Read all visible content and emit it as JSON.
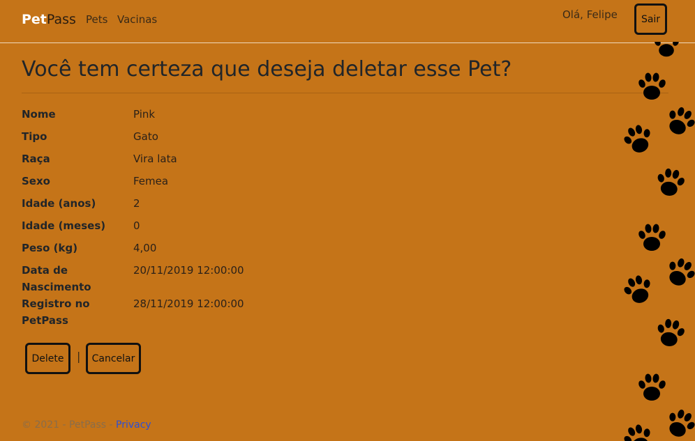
{
  "navbar": {
    "brand_bold": "Pet",
    "brand_light": "Pass",
    "links": [
      "Pets",
      "Vacinas"
    ],
    "greeting": "Olá, Felipe",
    "logout_label": "Sair"
  },
  "page": {
    "title": "Você tem certeza que deseja deletar esse Pet?"
  },
  "details": {
    "nome": {
      "label": "Nome",
      "value": "Pink"
    },
    "tipo": {
      "label": "Tipo",
      "value": "Gato"
    },
    "raca": {
      "label": "Raça",
      "value": "Vira lata"
    },
    "sexo": {
      "label": "Sexo",
      "value": "Femea"
    },
    "idade_anos": {
      "label": "Idade (anos)",
      "value": "2"
    },
    "idade_meses": {
      "label": "Idade (meses)",
      "value": "0"
    },
    "peso": {
      "label": "Peso (kg)",
      "value": "4,00"
    },
    "nascimento": {
      "label_line1": "Data de",
      "label_line2": "Nascimento",
      "value": "20/11/2019 12:00:00"
    },
    "registro": {
      "label_line1": "Registro no",
      "label_line2": "PetPass",
      "value": "28/11/2019 12:00:00"
    }
  },
  "actions": {
    "delete_label": "Delete",
    "separator": "|",
    "cancel_label": "Cancelar"
  },
  "footer": {
    "text": "© 2021 - PetPass - ",
    "privacy_link": "Privacy"
  },
  "colors": {
    "background": "#c57418",
    "paw": "#000000",
    "link": "#2b4fd6"
  },
  "icons": [
    "paw-print-icon"
  ]
}
